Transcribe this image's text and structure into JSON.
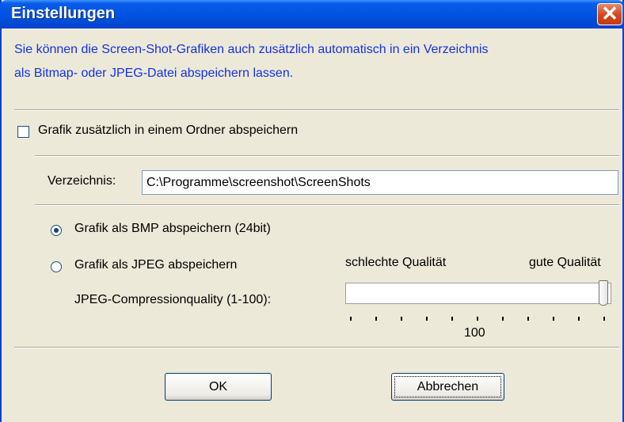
{
  "window": {
    "title": "Einstellungen",
    "close_glyph": "✕"
  },
  "info_text": {
    "line1": "Sie können die Screen-Shot-Grafiken auch zusätzlich automatisch in ein Verzeichnis",
    "line2": "als Bitmap- oder JPEG-Datei abspeichern lassen."
  },
  "save_checkbox": {
    "label": "Grafik zusätzlich in einem Ordner abspeichern",
    "checked": false
  },
  "directory": {
    "label": "Verzeichnis:",
    "value": "C:\\Programme\\screenshot\\ScreenShots"
  },
  "format_options": [
    {
      "label": "Grafik als BMP abspeichern (24bit)",
      "selected": true
    },
    {
      "label": "Grafik als JPEG abspeichern",
      "selected": false
    }
  ],
  "jpeg_quality": {
    "label": "JPEG-Compressionquality (1-100):",
    "low_label": "schlechte Qualität",
    "high_label": "gute Qualität",
    "value": 100,
    "value_text": "100"
  },
  "buttons": {
    "ok": "OK",
    "cancel": "Abbrechen"
  },
  "colors": {
    "title_bar": "#0054e3",
    "info_text": "#1432e0",
    "close_button": "#d2451f",
    "dialog_bg": "#ece9d8"
  },
  "icons": {
    "close": "close-icon"
  }
}
